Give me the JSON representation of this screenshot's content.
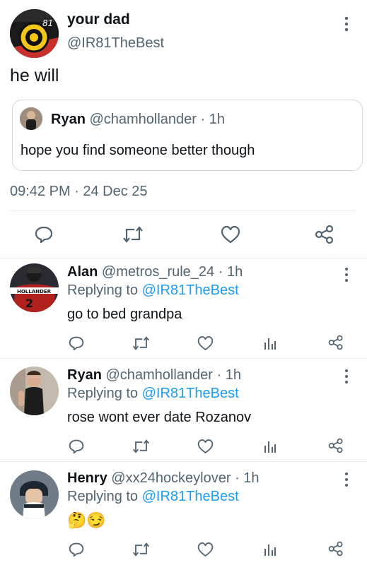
{
  "tweet": {
    "author_name": "your dad",
    "author_handle": "@IR81TheBest",
    "text": "he will",
    "timestamp": "09:42 PM · 24 Dec 25",
    "avatar_number": "81",
    "quoted": {
      "author_name": "Ryan",
      "author_handle": "@chamhollander · 1h",
      "text": "hope you find someone better though"
    }
  },
  "replies": [
    {
      "name": "Alan",
      "handle": "@metros_rule_24 · 1h",
      "replying_prefix": "Replying to",
      "replying_to": "@IR81TheBest",
      "text": "go to bed grandpa",
      "avatar_jersey_text": "HOLLANDER"
    },
    {
      "name": "Ryan",
      "handle": "@chamhollander · 1h",
      "replying_prefix": "Replying to",
      "replying_to": "@IR81TheBest",
      "text": "rose wont ever date Rozanov"
    },
    {
      "name": "Henry",
      "handle": "@xx24hockeylover · 1h",
      "replying_prefix": "Replying to",
      "replying_to": "@IR81TheBest",
      "text": "🤔😏"
    }
  ],
  "colors": {
    "accent": "#1d9bf0",
    "muted": "#536471",
    "divider": "#e6ecf0"
  },
  "icons": [
    "more-vertical-icon",
    "reply-icon",
    "retweet-icon",
    "like-icon",
    "analytics-icon",
    "share-icon"
  ]
}
